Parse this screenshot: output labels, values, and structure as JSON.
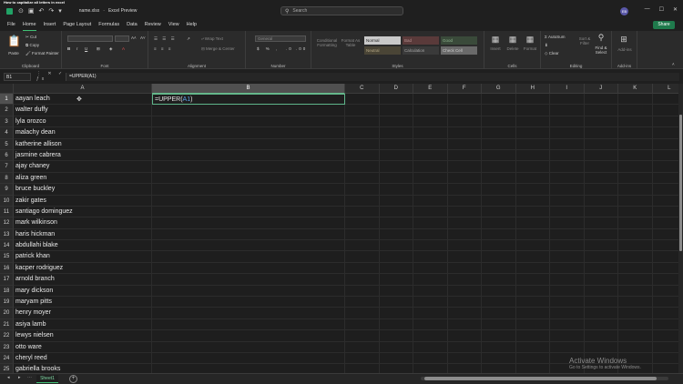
{
  "video_caption": "How to capitalize all letters in excel",
  "titlebar": {
    "file_name": "name.xlsx",
    "app_name": "Excel Preview",
    "search_placeholder": "Search",
    "avatar_initials": "EB"
  },
  "menu": {
    "tabs": [
      "File",
      "Home",
      "Insert",
      "Page Layout",
      "Formulas",
      "Data",
      "Review",
      "View",
      "Help"
    ],
    "active": "Home",
    "share_label": "Share"
  },
  "ribbon": {
    "clipboard": {
      "paste": "Paste",
      "cut": "Cut",
      "copy": "Copy",
      "format_painter": "Format Painter",
      "label": "Clipboard"
    },
    "font": {
      "label": "Font"
    },
    "alignment": {
      "wrap_text": "Wrap Text",
      "merge_center": "Merge & Center",
      "label": "Alignment"
    },
    "number": {
      "format": "General",
      "label": "Number"
    },
    "styles": {
      "conditional_formatting": "Conditional Formatting",
      "format_as_table": "Format As Table",
      "cells": [
        {
          "label": "Normal",
          "bg": "#c9c9c9",
          "fg": "#222222"
        },
        {
          "label": "Bad",
          "bg": "#5a3a3a",
          "fg": "#b59090"
        },
        {
          "label": "Good",
          "bg": "#3a4a3a",
          "fg": "#90b590"
        },
        {
          "label": "Neutral",
          "bg": "#4a4536",
          "fg": "#b5a886"
        },
        {
          "label": "Calculation",
          "bg": "#3a3a3a",
          "fg": "#a8a8a8"
        },
        {
          "label": "Check Cell",
          "bg": "#6a6a6a",
          "fg": "#cfcfcf"
        }
      ],
      "label": "Styles"
    },
    "cells": {
      "insert": "Insert",
      "delete": "Delete",
      "format": "Format",
      "label": "Cells"
    },
    "editing": {
      "autosum": "AutoSum",
      "clear": "Clear",
      "sort_filter": "Sort & Filter",
      "find_select": "Find & Select",
      "label": "Editing"
    },
    "addins": {
      "addins": "Add-ins",
      "label": "Add-ins"
    }
  },
  "formula_bar": {
    "name_box": "B1",
    "formula": "=UPPER(A1)"
  },
  "grid": {
    "columns": [
      "A",
      "B",
      "C",
      "D",
      "E",
      "F",
      "G",
      "H",
      "I",
      "J",
      "K",
      "L"
    ],
    "selected_column": "B",
    "selected_row": 1,
    "active_cell": {
      "prefix": "=UPPER(",
      "ref": "A1",
      "suffix": ")"
    },
    "rows": [
      "aayan leach",
      "walter duffy",
      "lyla orozco",
      "malachy dean",
      "katherine allison",
      "jasmine cabrera",
      "ajay chaney",
      "aliza green",
      "bruce buckley",
      "zakir gates",
      "santiago dominguez",
      "mark wilkinson",
      "haris hickman",
      "abdullahi blake",
      "patrick khan",
      "kacper rodriguez",
      "arnold branch",
      "mary dickson",
      "maryam pitts",
      "henry moyer",
      "asiya lamb",
      "lewys nielsen",
      "otto ware",
      "cheryl reed",
      "gabriella brooks"
    ]
  },
  "sheets": {
    "tabs": [
      "Sheet1"
    ],
    "active": "Sheet1"
  },
  "watermark": {
    "line1": "Activate Windows",
    "line2": "Go to Settings to activate Windows."
  }
}
